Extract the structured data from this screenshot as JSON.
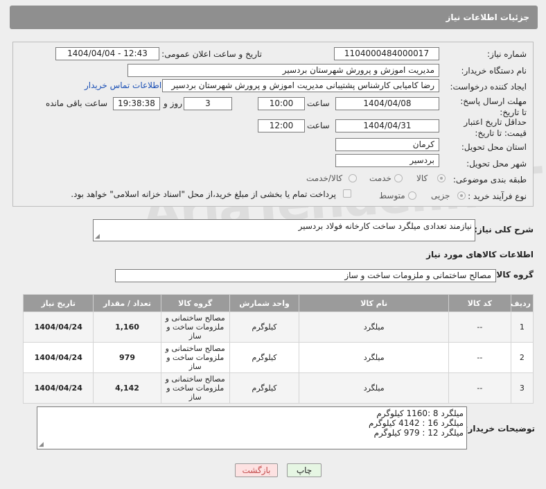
{
  "header": {
    "title": "جزئیات اطلاعات نیاز"
  },
  "watermark": "AriaTender.neT",
  "form": {
    "need_number": {
      "label": "شماره نیاز:",
      "value": "1104000484000017"
    },
    "announce": {
      "label": "تاریخ و ساعت اعلان عمومی:",
      "value": "1404/04/04 - 12:43"
    },
    "buyer_org": {
      "label": "نام دستگاه خریدار:",
      "value": "مدیریت اموزش و پرورش شهرستان بردسیر"
    },
    "requester": {
      "label": "ایجاد کننده درخواست:",
      "value": "رضا کامیابی کارشناس پشتیبانی مدیریت اموزش و پرورش شهرستان بردسیر",
      "contact_link": "اطلاعات تماس خریدار"
    },
    "deadline": {
      "label": "مهلت ارسال پاسخ: تا تاریخ:",
      "date": "1404/04/08",
      "time_label": "ساعت",
      "time": "10:00",
      "days": "3",
      "days_label": "روز و",
      "remaining": "19:38:38",
      "remaining_label": "ساعت باقی مانده"
    },
    "validity": {
      "label": "حداقل تاریخ اعتبار قیمت: تا تاریخ:",
      "date": "1404/04/31",
      "time_label": "ساعت",
      "time": "12:00"
    },
    "province": {
      "label": "استان محل تحویل:",
      "value": "کرمان"
    },
    "city": {
      "label": "شهر محل تحویل:",
      "value": "بردسیر"
    },
    "category": {
      "label": "طبقه بندی موضوعی:",
      "options": [
        "کالا",
        "خدمت",
        "کالا/خدمت"
      ],
      "selected": "کالا"
    },
    "purchase": {
      "label": "نوع فرآیند خرید :",
      "options": [
        "جزیی",
        "متوسط"
      ],
      "selected": "جزیی",
      "payment_note": "پرداخت تمام یا بخشی از مبلغ خرید،از محل \"اسناد خزانه اسلامی\" خواهد بود."
    }
  },
  "description": {
    "label": "شرح کلی نیاز:",
    "value": "نیازمند تعدادی میلگرد ساخت کارخانه فولاد  بردسیر"
  },
  "goods": {
    "section_title": "اطلاعات کالاهای مورد نیاز",
    "group_label": "گروه کالا:",
    "group_value": "مصالح ساختمانی و ملزومات ساخت و ساز",
    "columns": [
      "ردیف",
      "کد کالا",
      "نام کالا",
      "واحد شمارش",
      "گروه کالا",
      "تعداد / مقدار",
      "تاریخ نیاز"
    ],
    "rows": [
      {
        "row": "1",
        "code": "--",
        "name": "میلگرد",
        "unit": "کیلوگرم",
        "group": "مصالح ساختمانی و ملزومات ساخت و ساز",
        "qty": "1,160",
        "date": "1404/04/24"
      },
      {
        "row": "2",
        "code": "--",
        "name": "میلگرد",
        "unit": "کیلوگرم",
        "group": "مصالح ساختمانی و ملزومات ساخت و ساز",
        "qty": "979",
        "date": "1404/04/24"
      },
      {
        "row": "3",
        "code": "--",
        "name": "میلگرد",
        "unit": "کیلوگرم",
        "group": "مصالح ساختمانی و ملزومات ساخت و ساز",
        "qty": "4,142",
        "date": "1404/04/24"
      }
    ]
  },
  "buyer_notes": {
    "label": "توضیحات خریدار:",
    "text": "میلگرد 8 :1160 کیلوگرم\nمیلگرد 16 : 4142 کیلوگرم\nمیلگرد 12 : 979 کیلوگرم"
  },
  "buttons": {
    "print": "چاپ",
    "back": "بازگشت"
  },
  "colors": {
    "header_bg": "#8f8f8f",
    "link": "#1a4fb5",
    "print_bg": "#e6f6e3",
    "back_bg": "#fde2e2"
  }
}
